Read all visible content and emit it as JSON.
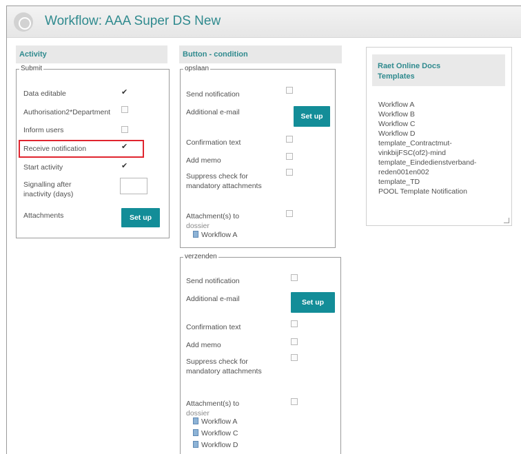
{
  "header": {
    "title": "Workflow: AAA Super DS New"
  },
  "activity": {
    "heading": "Activity",
    "group_legend": "Submit",
    "rows": [
      {
        "label": "Data editable",
        "checked": true
      },
      {
        "label": "Authorisation2*Department",
        "checked": false
      },
      {
        "label": "Inform users",
        "checked": false
      },
      {
        "label": "Receive notification",
        "checked": true
      },
      {
        "label": "Start activity",
        "checked": true
      }
    ],
    "signalling_label_1": "Signalling after",
    "signalling_label_2": "inactivity (days)",
    "signalling_value": "",
    "attachments_label": "Attachments",
    "setup_label": "Set up"
  },
  "button_condition": {
    "heading": "Button - condition",
    "opslaan": {
      "legend": "opslaan",
      "send_notification": "Send notification",
      "additional_email": "Additional e-mail",
      "setup_label": "Set up",
      "confirmation_text": "Confirmation text",
      "add_memo": "Add memo",
      "suppress_1": "Suppress check for",
      "suppress_2": "mandatory attachments",
      "attachments_1": "Attachment(s) to",
      "attachments_2": "dossier",
      "attached": [
        "Workflow A"
      ]
    },
    "verzenden": {
      "legend": "verzenden",
      "send_notification": "Send notification",
      "additional_email": "Additional e-mail",
      "setup_label": "Set up",
      "confirmation_text": "Confirmation text",
      "add_memo": "Add memo",
      "suppress_1": "Suppress check for",
      "suppress_2": "mandatory attachments",
      "attachments_1": "Attachment(s) to",
      "attachments_2": "dossier",
      "attached": [
        "Workflow A",
        "Workflow C",
        "Workflow D"
      ]
    }
  },
  "templates": {
    "heading_1": "Raet Online Docs",
    "heading_2": "Templates",
    "items": [
      "Workflow A",
      "Workflow B",
      "Workflow C",
      "Workflow D",
      "template_Contractmut-",
      "vinkbijFSC(of2)-mind",
      "template_Eindedienstverband-",
      "reden001en002",
      "template_TD",
      "POOL Template Notification"
    ]
  },
  "colors": {
    "accent": "#2f8a8e",
    "button": "#138d98",
    "highlight": "#e0242e"
  }
}
